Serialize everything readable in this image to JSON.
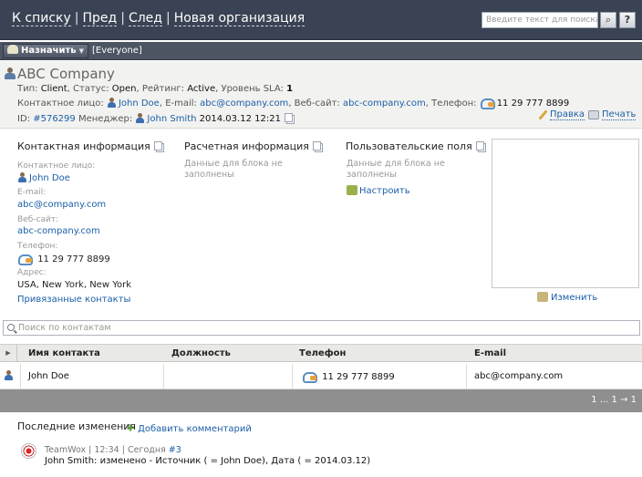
{
  "nav": {
    "back": "К списку",
    "prev": "Пред",
    "next": "След",
    "new_org": "Новая организация",
    "sep": "|"
  },
  "search": {
    "placeholder": "Введите текст для поиска",
    "help": "?"
  },
  "toolbar": {
    "assign": "Назначить",
    "group": "[Everyone]"
  },
  "company": {
    "name": "ABC Company",
    "type_label": "Тип:",
    "type": "Client",
    "status_label": "Статус:",
    "status": "Open",
    "rating_label": "Рейтинг:",
    "rating": "Active",
    "sla_label": "Уровень SLA:",
    "sla": "1",
    "contact_label": "Контактное лицо:",
    "contact": "John Doe",
    "email_label": "E-mail:",
    "email": "abc@company.com",
    "website_label": "Веб-сайт:",
    "website": "abc-company.com",
    "phone_label": "Телефон:",
    "phone": "11 29 777 8899",
    "id_label": "ID:",
    "id": "#576299",
    "manager_label": "Менеджер:",
    "manager": "John Smith",
    "date": "2014.03.12 12:21",
    "edit": "Правка",
    "print": "Печать"
  },
  "contact_info": {
    "title": "Контактная информация",
    "contact_label": "Контактное лицо:",
    "contact": "John Doe",
    "email_label": "E-mail:",
    "email": "abc@company.com",
    "website_label": "Веб-сайт:",
    "website": "abc-company.com",
    "phone_label": "Телефон:",
    "phone": "11 29 777 8899",
    "address_label": "Адрес:",
    "address": "USA, New York, New York",
    "linked": "Привязанные контакты"
  },
  "billing": {
    "title": "Расчетная информация",
    "empty": "Данные для блока не заполнены"
  },
  "custom_fields": {
    "title": "Пользовательские поля",
    "empty": "Данные для блока не заполнены",
    "configure": "Настроить"
  },
  "side": {
    "change": "Изменить"
  },
  "contacts": {
    "search_placeholder": "Поиск по контактам",
    "columns": [
      "Имя контакта",
      "Должность",
      "Телефон",
      "E-mail"
    ],
    "rows": [
      {
        "name": "John Doe",
        "position": "",
        "phone": "11 29 777 8899",
        "email": "abc@company.com"
      }
    ],
    "pager": "1 ... 1 → 1"
  },
  "changes": {
    "title": "Последние изменения",
    "add_comment": "Добавить комментарий",
    "entry": {
      "source": "TeamWox",
      "time": "12:34",
      "day": "Сегодня",
      "num": "#3",
      "text": "John Smith: изменено - Источник ( = John Doe), Дата ( = 2014.03.12)"
    }
  }
}
